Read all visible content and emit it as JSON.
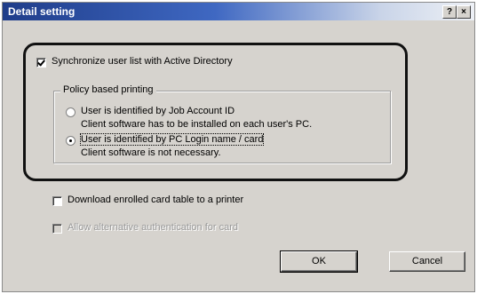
{
  "dialog": {
    "title": "Detail setting",
    "help_button": "?",
    "close_button": "×"
  },
  "options": {
    "sync_ad": {
      "label": "Synchronize user list with Active Directory",
      "checked": true
    },
    "download_table": {
      "label": "Download enrolled card table to a printer",
      "checked": false
    },
    "alt_auth": {
      "label": "Allow alternative authentication for card",
      "checked": false,
      "enabled": false
    }
  },
  "policy": {
    "title": "Policy based printing",
    "job_account": {
      "label": "User is identified by Job Account ID",
      "note": "Client software has to be installed on each user's PC.",
      "selected": false
    },
    "pc_login": {
      "label": "User is identified by PC Login name / card",
      "note": "Client software is not necessary.",
      "selected": true
    }
  },
  "buttons": {
    "ok": "OK",
    "cancel": "Cancel"
  }
}
